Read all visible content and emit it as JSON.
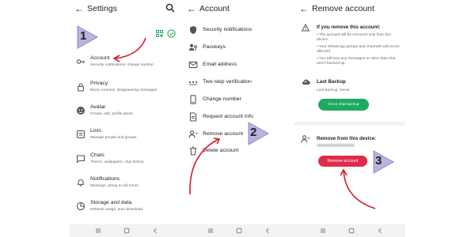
{
  "panel1": {
    "title": "Settings",
    "items": [
      {
        "label": "Account",
        "sub": "Security notifications, change number",
        "icon": "key-icon"
      },
      {
        "label": "Privacy",
        "sub": "Block contacts, disappearing messages",
        "icon": "lock-icon"
      },
      {
        "label": "Avatar",
        "sub": "Create, edit, profile photo",
        "icon": "avatar-icon"
      },
      {
        "label": "Lists",
        "sub": "Manage people and groups",
        "icon": "lists-icon"
      },
      {
        "label": "Chats",
        "sub": "Theme, wallpapers, chat history",
        "icon": "chat-icon"
      },
      {
        "label": "Notifications",
        "sub": "Message, group & call tones",
        "icon": "bell-icon"
      },
      {
        "label": "Storage and data",
        "sub": "Network usage, auto-download",
        "icon": "storage-icon"
      }
    ]
  },
  "panel2": {
    "title": "Account",
    "items": [
      {
        "label": "Security notifications",
        "icon": "shield-icon"
      },
      {
        "label": "Passkeys",
        "icon": "passkey-icon"
      },
      {
        "label": "Email address",
        "icon": "mail-icon"
      },
      {
        "label": "Two-step verification",
        "icon": "dots-icon"
      },
      {
        "label": "Change number",
        "icon": "phone-icon"
      },
      {
        "label": "Request account info",
        "icon": "document-icon"
      },
      {
        "label": "Remove account",
        "icon": "person-remove-icon"
      },
      {
        "label": "Delete account",
        "icon": "trash-icon"
      }
    ]
  },
  "panel3": {
    "title": "Remove account",
    "warning_title": "If you remove this account:",
    "bullets": [
      "• The account will be removed only from this device",
      "• Your WhatsApp groups and channels will not be affected",
      "• You will lose any messages or other data that aren't backed up"
    ],
    "backup_title": "Last Backup",
    "backup_value": "Last Backup: Never",
    "backup_button": "Go to chat backup",
    "remove_title": "Remove from this device:",
    "remove_button": "Remove account"
  },
  "steps": [
    "1",
    "2",
    "3"
  ],
  "colors": {
    "accent_green": "#1daa61",
    "danger_red": "#e02c4a",
    "arrow_red": "#d21f2b",
    "step_flag": "#b8b4de"
  }
}
